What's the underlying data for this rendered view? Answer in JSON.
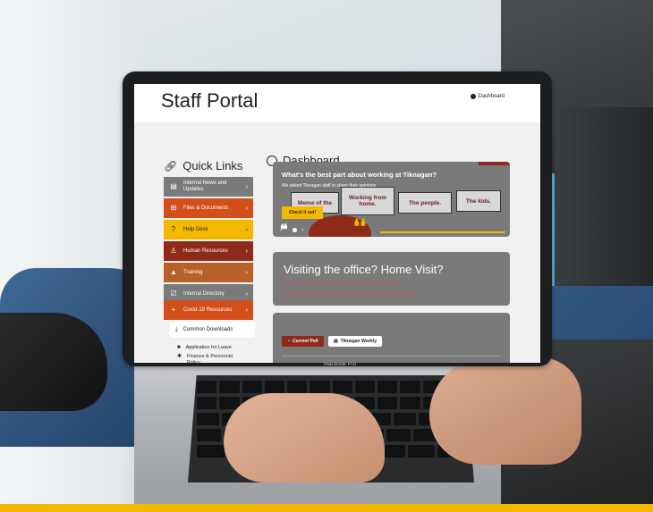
{
  "portal": {
    "title": "Staff Portal",
    "top_nav": "Dashboard"
  },
  "quick_links": {
    "heading": "Quick Links",
    "items": [
      {
        "label": "Internal News and Updates",
        "color": "#7a7a7a",
        "icon": "news-icon"
      },
      {
        "label": "Files & Documents",
        "color": "#d24e1a",
        "icon": "folder-tree-icon"
      },
      {
        "label": "Help Desk",
        "color": "#f5b800",
        "icon": "help-icon"
      },
      {
        "label": "Human Resources",
        "color": "#8e2a1a",
        "icon": "people-icon"
      },
      {
        "label": "Training",
        "color": "#b8602a",
        "icon": "graduation-cap-icon"
      },
      {
        "label": "Internal Directory",
        "color": "#7a7a7a",
        "icon": "directory-icon"
      },
      {
        "label": "Covid-19 Resources",
        "color": "#d24e1a",
        "icon": "medical-icon"
      }
    ],
    "common_downloads": "Common Downloads",
    "documents": [
      "Application for Leave",
      "Finance & Personnel Policy"
    ]
  },
  "dashboard": {
    "heading": "Dashboard",
    "banner": {
      "question": "What's the best part about working at Tiknagan?",
      "subtitle": "We asked Tiknagan staff to share their opinions",
      "quotes": [
        "Meme of the",
        "Working from home.",
        "The people.",
        "The kids."
      ],
      "button": "Check it out!"
    },
    "visit": {
      "title": "Visiting the office? Home Visit?",
      "line1": "Complete the daily COVID-19 Health Screening Check here",
      "line2": "Complete the Home Visit COVID-19 Health Screening Check here"
    },
    "poll": {
      "tab1": "Current Poll",
      "tab2": "Tiknagan Weekly"
    }
  },
  "laptop": {
    "brand_label": "MacBook Pro"
  },
  "colors": {
    "accent_yellow": "#f5b800",
    "accent_red": "#8e2a1a",
    "accent_orange": "#d24e1a",
    "card_gray": "#7a7a7a"
  }
}
